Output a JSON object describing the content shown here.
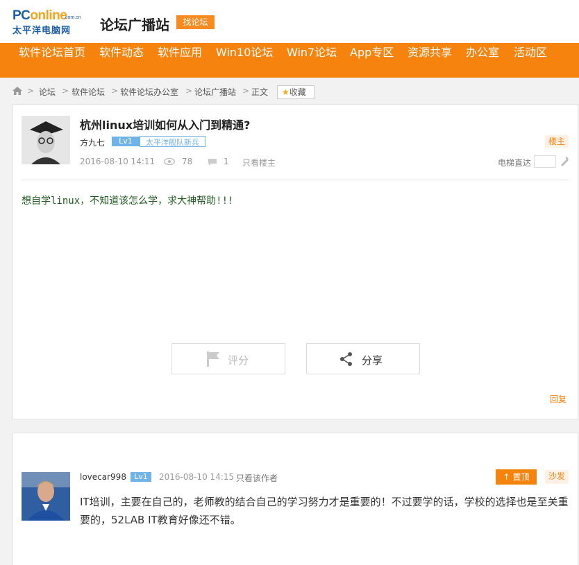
{
  "header": {
    "logo_line1_p": "PC",
    "logo_line1_rest": "online",
    "logo_domain": ".com.cn",
    "logo_line2": "太平洋电脑网",
    "site_title": "论坛广播站",
    "find_forum": "找论坛"
  },
  "nav": {
    "items": [
      "软件论坛首页",
      "软件动态",
      "软件应用",
      "Win10论坛",
      "Win7论坛",
      "App专区",
      "资源共享",
      "办公室",
      "活动区"
    ]
  },
  "breadcrumb": {
    "items": [
      "论坛",
      "软件论坛",
      "软件论坛办公室",
      "论坛广播站",
      "正文"
    ],
    "separator": ">",
    "favorite": "收藏"
  },
  "thread": {
    "title": "杭州linux培训如何从入门到精通?",
    "author": "方九七",
    "level": "Lv1",
    "rank": "太平洋舰队新兵",
    "owner_tag": "楼主",
    "date": "2016-08-10 14:11",
    "views": "78",
    "replies": "1",
    "only_owner": "只看楼主",
    "elevator": "电梯直达",
    "content": "想自学linux，不知道该怎么学，求大神帮助!!!",
    "rate_label": "评分",
    "share_label": "分享",
    "reply_label": "回复"
  },
  "reply": {
    "author": "lovecar998",
    "level": "Lv1",
    "date": "2016-08-10 14:15",
    "only_author": "只看该作者",
    "top_label": "置顶",
    "floor_tag": "沙发",
    "content": "IT培训，主要在自己的，老师教的结合自己的学习努力才是重要的！不过要学的话，学校的选择也是至关重要的，52LAB IT教育好像还不错。"
  },
  "colors": {
    "nav_bg": "#f7830f",
    "accent": "#f68b1f",
    "level_badge": "#6fb3e8",
    "content_text": "#1e5c1e"
  }
}
